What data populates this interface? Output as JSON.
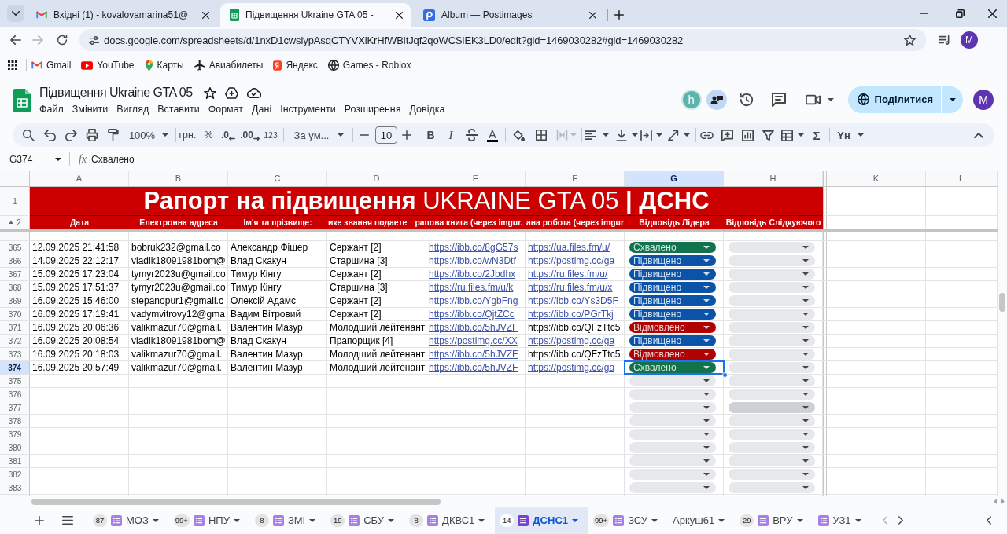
{
  "browser": {
    "tabs": [
      {
        "kind": "mail",
        "title": "Вхідні (1) - kovalovamarina51@",
        "selected": false
      },
      {
        "kind": "spreadsheet",
        "title": "Підвищення Ukraine GTA 05 -",
        "selected": true
      },
      {
        "kind": "image-host",
        "title": "Album — Postimages",
        "selected": false
      }
    ],
    "url": "docs.google.com/spreadsheets/d/1nxD1cwslypAsqCTYVXiKrHfWBitJqf2qoWCSlEK3LD0/edit?gid=1469030282#gid=1469030282",
    "profile_initial": "M",
    "bookmarks": [
      {
        "kind": "mail",
        "label": "Gmail"
      },
      {
        "kind": "video",
        "label": "YouTube"
      },
      {
        "kind": "map",
        "label": "Карты"
      },
      {
        "kind": "plane",
        "label": "Авиабилеты"
      },
      {
        "kind": "search",
        "label": "Яндекс"
      },
      {
        "kind": "globe",
        "label": "Games - Roblox"
      }
    ]
  },
  "document": {
    "title": "Підвищення Ukraine GTA 05",
    "menu": [
      "Файл",
      "Змінити",
      "Вигляд",
      "Вставити",
      "Формат",
      "Дані",
      "Інструменти",
      "Розширення",
      "Довідка"
    ],
    "collaborator_initial": "h",
    "share_label": "Поділитися",
    "account_initial": "M"
  },
  "toolbar": {
    "zoom": "100%",
    "currency": "грн.",
    "percent": "%",
    "decrease_decimals": ".0",
    "increase_decimals": ".00",
    "number_format": "123",
    "font": "За ум...",
    "font_size": "10",
    "bold": "B",
    "italic": "I",
    "text_color": "A",
    "sum": "Σ",
    "input_tools": "Yн"
  },
  "formula_bar": {
    "name_box": "G374",
    "function_label": "fx",
    "formula": "Схвалено"
  },
  "grid": {
    "columns": [
      {
        "letter": "A",
        "selected": false
      },
      {
        "letter": "B",
        "selected": false
      },
      {
        "letter": "C",
        "selected": false
      },
      {
        "letter": "D",
        "selected": false
      },
      {
        "letter": "E",
        "selected": false
      },
      {
        "letter": "F",
        "selected": false
      },
      {
        "letter": "G",
        "selected": true
      },
      {
        "letter": "H",
        "selected": false
      },
      {
        "letter": "K",
        "selected": false
      },
      {
        "letter": "L",
        "selected": false
      }
    ],
    "title_row": {
      "number": "1",
      "text": "**Рапорт на підвищення** UKRAINE GTA 05 **| ДСНС**"
    },
    "header_row": {
      "number": "2",
      "cells": [
        "Дата",
        "Електронна адреса",
        "Ім'я та прізвище:",
        "ике звання подаете",
        "рапова книга (через imgur.",
        "ана робота (через imgur",
        "Відповідь Лідера",
        "Відповідь Слідкуючого"
      ]
    },
    "rows": [
      {
        "number": "365",
        "cells": [
          {
            "kind": "text",
            "text": "12.09.2025 21:41:58"
          },
          {
            "kind": "text",
            "text": "bobruk232@gmail.co"
          },
          {
            "kind": "text",
            "text": "Александр Фішер"
          },
          {
            "kind": "text",
            "text": "Сержант [2]"
          },
          {
            "kind": "link",
            "text": "https://ibb.co/8gG57s"
          },
          {
            "kind": "link",
            "text": "https://ua.files.fm/u/"
          }
        ],
        "leader_answer": {
          "label": "Схвалено",
          "color": "#11734b",
          "selected": false
        },
        "follower_answer": {
          "color": "#e6e8ec"
        }
      },
      {
        "number": "366",
        "cells": [
          {
            "kind": "text",
            "text": "14.09.2025 22:12:17"
          },
          {
            "kind": "text",
            "text": "vladik18091981bom@"
          },
          {
            "kind": "text",
            "text": "Влад Скакун"
          },
          {
            "kind": "text",
            "text": "Старшина [3]"
          },
          {
            "kind": "link",
            "text": "https://ibb.co/wN3Dtf"
          },
          {
            "kind": "link",
            "text": "https://postimg.cc/ga"
          }
        ],
        "leader_answer": {
          "label": "Підвищено",
          "color": "#0a53a8",
          "selected": false
        },
        "follower_answer": {
          "color": "#e6e8ec"
        }
      },
      {
        "number": "367",
        "cells": [
          {
            "kind": "text",
            "text": "15.09.2025 17:23:04"
          },
          {
            "kind": "text",
            "text": "tymyr2023u@gmail.co"
          },
          {
            "kind": "text",
            "text": "Тимур Кінгу"
          },
          {
            "kind": "text",
            "text": "Сержант [2]"
          },
          {
            "kind": "link",
            "text": "https://ibb.co/2Jbdhx"
          },
          {
            "kind": "link",
            "text": "https://ru.files.fm/u/"
          }
        ],
        "leader_answer": {
          "label": "Підвищено",
          "color": "#0a53a8",
          "selected": false
        },
        "follower_answer": {
          "color": "#e6e8ec"
        }
      },
      {
        "number": "368",
        "cells": [
          {
            "kind": "text",
            "text": "15.09.2025 17:51:37"
          },
          {
            "kind": "text",
            "text": "tymyr2023u@gmail.co"
          },
          {
            "kind": "text",
            "text": "Тимур Кінгу"
          },
          {
            "kind": "text",
            "text": "Старшина [3]"
          },
          {
            "kind": "link",
            "text": "https://ru.files.fm/u/k"
          },
          {
            "kind": "link",
            "text": "https://ru.files.fm/u/x"
          }
        ],
        "leader_answer": {
          "label": "Підвищено",
          "color": "#0a53a8",
          "selected": false
        },
        "follower_answer": {
          "color": "#e6e8ec"
        }
      },
      {
        "number": "369",
        "cells": [
          {
            "kind": "text",
            "text": "16.09.2025 15:46:00"
          },
          {
            "kind": "text",
            "text": "stepanopur1@gmail.c"
          },
          {
            "kind": "text",
            "text": "Олексій Адамс"
          },
          {
            "kind": "text",
            "text": "Сержант [2]"
          },
          {
            "kind": "link",
            "text": "https://ibb.co/YgbFng"
          },
          {
            "kind": "link",
            "text": "https://ibb.co/Ys3D5F"
          }
        ],
        "leader_answer": {
          "label": "Підвищено",
          "color": "#0a53a8",
          "selected": false
        },
        "follower_answer": {
          "color": "#e6e8ec"
        }
      },
      {
        "number": "370",
        "cells": [
          {
            "kind": "text",
            "text": "16.09.2025 17:19:41"
          },
          {
            "kind": "text",
            "text": "vadymvitrovy12@gma"
          },
          {
            "kind": "text",
            "text": "Вадим Вітровий"
          },
          {
            "kind": "text",
            "text": "Сержант [2]"
          },
          {
            "kind": "link",
            "text": "https://ibb.co/QjtZCc"
          },
          {
            "kind": "link",
            "text": "https://ibb.co/PGrTkj"
          }
        ],
        "leader_answer": {
          "label": "Підвищено",
          "color": "#0a53a8",
          "selected": false
        },
        "follower_answer": {
          "color": "#e6e8ec"
        }
      },
      {
        "number": "371",
        "cells": [
          {
            "kind": "text",
            "text": "16.09.2025 20:06:36"
          },
          {
            "kind": "text",
            "text": "valikmazur70@gmail."
          },
          {
            "kind": "text",
            "text": "Валентин Мазур"
          },
          {
            "kind": "text",
            "text": "Молодший лейтенант"
          },
          {
            "kind": "link",
            "text": "https://ibb.co/5hJVZF"
          },
          {
            "kind": "text",
            "text": "https://ibb.co/QFzTtc5"
          }
        ],
        "leader_answer": {
          "label": "Відмовлено",
          "color": "#b10202",
          "selected": false
        },
        "follower_answer": {
          "color": "#e6e8ec"
        }
      },
      {
        "number": "372",
        "cells": [
          {
            "kind": "text",
            "text": "16.09.2025 20:08:54"
          },
          {
            "kind": "text",
            "text": "vladik18091981bom@"
          },
          {
            "kind": "text",
            "text": "Влад Скакун"
          },
          {
            "kind": "text",
            "text": "Прапорщик [4]"
          },
          {
            "kind": "link",
            "text": "https://postimg.cc/XX"
          },
          {
            "kind": "link",
            "text": "https://postimg.cc/ga"
          }
        ],
        "leader_answer": {
          "label": "Підвищено",
          "color": "#0a53a8",
          "selected": false
        },
        "follower_answer": {
          "color": "#e6e8ec"
        }
      },
      {
        "number": "373",
        "cells": [
          {
            "kind": "text",
            "text": "16.09.2025 20:18:03"
          },
          {
            "kind": "text",
            "text": "valikmazur70@gmail."
          },
          {
            "kind": "text",
            "text": "Валентин Мазур"
          },
          {
            "kind": "text",
            "text": "Молодший лейтенант"
          },
          {
            "kind": "link",
            "text": "https://ibb.co/5hJVZF"
          },
          {
            "kind": "text",
            "text": "https://ibb.co/QFzTtc5"
          }
        ],
        "leader_answer": {
          "label": "Відмовлено",
          "color": "#b10202",
          "selected": false
        },
        "follower_answer": {
          "color": "#e6e8ec"
        }
      },
      {
        "number": "374",
        "cells": [
          {
            "kind": "text",
            "text": "16.09.2025 20:57:49"
          },
          {
            "kind": "text",
            "text": "valikmazur70@gmail."
          },
          {
            "kind": "text",
            "text": "Валентин Мазур"
          },
          {
            "kind": "text",
            "text": "Молодший лейтенант"
          },
          {
            "kind": "link",
            "text": "https://ibb.co/5hJVZF"
          },
          {
            "kind": "link",
            "text": "https://postimg.cc/ga"
          }
        ],
        "leader_answer": {
          "label": "Схвалено",
          "color": "#11734b",
          "selected": true
        },
        "follower_answer": {
          "color": "#e6e8ec"
        }
      },
      {
        "number": "375",
        "leader_answer": {
          "color": "#e6e8ec",
          "selected": false
        },
        "follower_answer": {
          "color": "#e6e8ec"
        }
      },
      {
        "number": "376",
        "leader_answer": {
          "color": "#e6e8ec",
          "selected": false
        },
        "follower_answer": {
          "color": "#e6e8ec"
        }
      },
      {
        "number": "377",
        "leader_answer": {
          "color": "#e6e8ec",
          "selected": false
        },
        "follower_answer": {
          "color": "#cdd0d5"
        }
      },
      {
        "number": "378",
        "leader_answer": {
          "color": "#e6e8ec",
          "selected": false
        },
        "follower_answer": {
          "color": "#e6e8ec"
        }
      },
      {
        "number": "379",
        "leader_answer": {
          "color": "#e6e8ec",
          "selected": false
        },
        "follower_answer": {
          "color": "#e6e8ec"
        }
      },
      {
        "number": "380",
        "leader_answer": {
          "color": "#e6e8ec",
          "selected": false
        },
        "follower_answer": {
          "color": "#e6e8ec"
        }
      },
      {
        "number": "381",
        "leader_answer": {
          "color": "#e6e8ec",
          "selected": false
        },
        "follower_answer": {
          "color": "#e6e8ec"
        }
      },
      {
        "number": "382",
        "leader_answer": {
          "color": "#e6e8ec",
          "selected": false
        },
        "follower_answer": {
          "color": "#e6e8ec"
        }
      },
      {
        "number": "383",
        "leader_answer": {
          "color": "#e6e8ec",
          "selected": false
        },
        "follower_answer": {
          "color": "#e6e8ec"
        }
      }
    ]
  },
  "sheet_tabs": [
    {
      "badge": "87",
      "form": true,
      "label": "МОЗ",
      "selected": false
    },
    {
      "badge": "99+",
      "form": true,
      "label": "НПУ",
      "selected": false
    },
    {
      "badge": "8",
      "form": true,
      "label": "ЗМІ",
      "selected": false
    },
    {
      "badge": "19",
      "form": true,
      "label": "СБУ",
      "selected": false
    },
    {
      "badge": "8",
      "form": true,
      "label": "ДКВС1",
      "selected": false
    },
    {
      "badge": "14",
      "form": true,
      "label": "ДСНС1",
      "selected": true
    },
    {
      "badge": "99+",
      "form": true,
      "label": "ЗСУ",
      "selected": false
    },
    {
      "form": false,
      "label": "Аркуш61",
      "selected": false
    },
    {
      "badge": "29",
      "form": true,
      "label": "ВРУ",
      "selected": false
    },
    {
      "form": true,
      "label": "УЗ1",
      "selected": false
    }
  ]
}
